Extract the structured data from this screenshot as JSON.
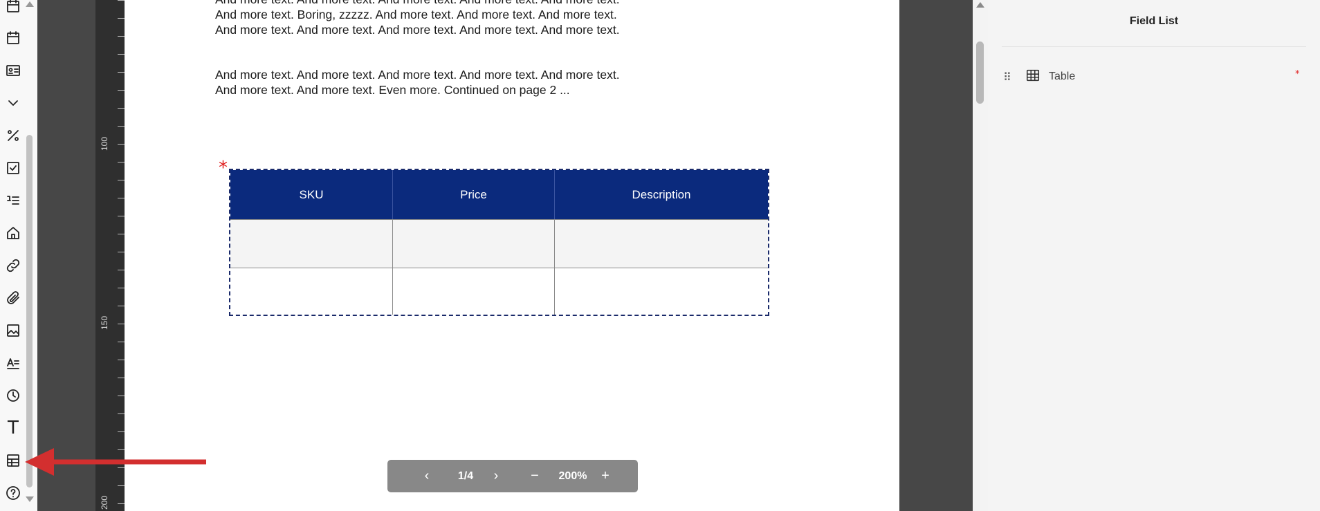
{
  "document": {
    "paragraph_1": "And more text. And more text. And more text. And more text. And more text. And more text. Boring, zzzzz. And more text. And more text. And more text. And more text. And more text. And more text. And more text. And more text.",
    "paragraph_2": "And more text. And more text. And more text. And more text. And more text. And more text. And more text. Even more. Continued on page 2 ..."
  },
  "table": {
    "required_marker": "*",
    "columns": [
      "SKU",
      "Price",
      "Description"
    ]
  },
  "ruler": {
    "labels": [
      "100",
      "150",
      "200"
    ]
  },
  "pager": {
    "prev_icon": "‹",
    "page_indicator": "1/4",
    "next_icon": "›",
    "zoom_out_icon": "−",
    "zoom_level": "200%",
    "zoom_in_icon": "+"
  },
  "field_list": {
    "title": "Field List",
    "items": [
      {
        "label": "Table",
        "icon": "table-icon",
        "required_marker": "*"
      }
    ]
  },
  "toolbar": {
    "icons": [
      "calendar-top-icon",
      "calendar-icon",
      "id-card-icon",
      "chevron-down-icon",
      "percent-icon",
      "checkbox-icon",
      "number-list-icon",
      "home-icon",
      "link-icon",
      "paperclip-icon",
      "image-icon",
      "text-lines-icon",
      "clock-icon",
      "text-icon",
      "table-icon",
      "help-icon"
    ],
    "text_glyph": "T",
    "help_glyph": "?"
  },
  "colors": {
    "table_header": "#0b2a7d",
    "annotation_arrow": "#d32f2f",
    "required": "#e02020"
  }
}
